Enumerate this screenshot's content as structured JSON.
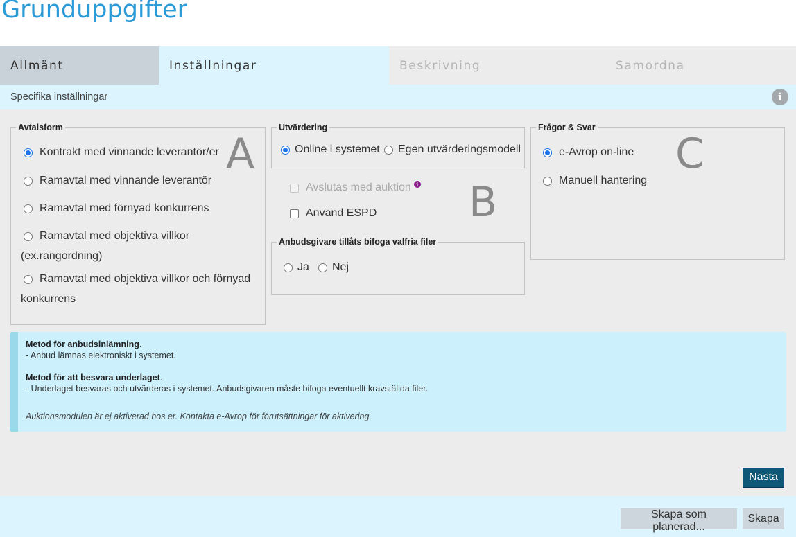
{
  "page": {
    "title": "Grunduppgifter"
  },
  "tabs": [
    {
      "label": "Allmänt"
    },
    {
      "label": "Inställningar"
    },
    {
      "label": "Beskrivning"
    },
    {
      "label": "Samordna"
    }
  ],
  "subheader": {
    "title": "Specifika inställningar",
    "info_icon": "i"
  },
  "avtalsform": {
    "legend": "Avtalsform",
    "letter": "A",
    "options": [
      {
        "label": "Kontrakt med vinnande leverantör/er",
        "checked": true
      },
      {
        "label": "Ramavtal med vinnande leverantör",
        "checked": false
      },
      {
        "label": "Ramavtal med förnyad konkurrens",
        "checked": false
      },
      {
        "label": "Ramavtal med objektiva villkor",
        "label2": "(ex.rangordning)",
        "checked": false
      },
      {
        "label": "Ramavtal med objektiva villkor och förnyad",
        "label2": "konkurrens",
        "checked": false
      }
    ]
  },
  "utvardering": {
    "legend": "Utvärdering",
    "options": [
      {
        "label": "Online i systemet",
        "checked": true
      },
      {
        "label": "Egen utvärderingsmodell",
        "checked": false
      }
    ]
  },
  "extras": {
    "letter": "B",
    "auction": {
      "label": "Avslutas med auktion",
      "checked": false,
      "disabled": true,
      "info_icon": "i"
    },
    "espd": {
      "label": "Använd ESPD",
      "checked": false
    }
  },
  "bifoga": {
    "legend": "Anbudsgivare tillåts bifoga valfria filer",
    "options": [
      {
        "label": "Ja",
        "checked": false
      },
      {
        "label": "Nej",
        "checked": false
      }
    ]
  },
  "fragor": {
    "legend": "Frågor & Svar",
    "letter": "C",
    "options": [
      {
        "label": "e-Avrop on-line",
        "checked": true
      },
      {
        "label": "Manuell hantering",
        "checked": false
      }
    ]
  },
  "notice": {
    "heading1": "Metod för anbudsinlämning",
    "line1": "- Anbud lämnas elektroniskt i systemet.",
    "heading2": "Metod för att besvara underlaget",
    "line2": "- Underlaget besvaras och utvärderas i systemet. Anbudsgivaren måste bifoga eventuellt kravställda filer.",
    "note": "Auktionsmodulen är ej aktiverad hos er. Kontakta e-Avrop för förutsättningar för aktivering."
  },
  "buttons": {
    "next": "Nästa",
    "create_planned": "Skapa som planerad...",
    "create": "Skapa"
  },
  "colors": {
    "accent": "#2a9bd6",
    "primary_button": "#0e5777",
    "radio_checked": "#1a73e8"
  }
}
